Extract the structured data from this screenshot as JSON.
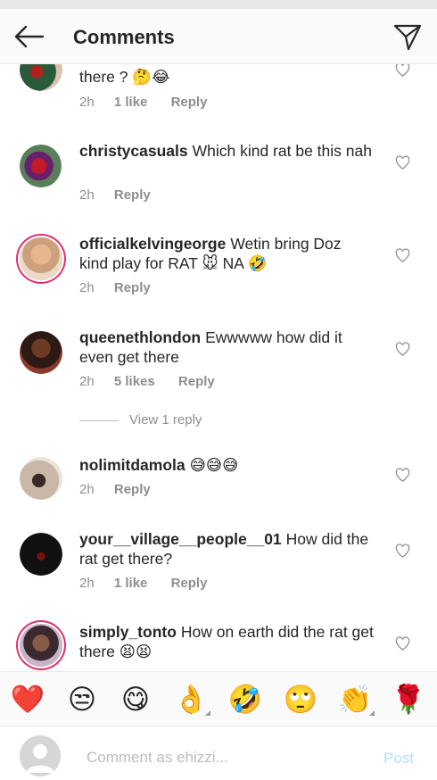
{
  "header": {
    "title": "Comments"
  },
  "comments": [
    {
      "text": "there ? 🤔😂",
      "time": "2h",
      "likes": "1 like",
      "reply": "Reply"
    },
    {
      "user": "christycasuals",
      "text": "Which kind rat be this nah",
      "time": "2h",
      "reply": "Reply"
    },
    {
      "user": "officialkelvingeorge",
      "text": "Wetin bring Doz kind play for RAT 🐭 NA 🤣",
      "time": "2h",
      "reply": "Reply"
    },
    {
      "user": "queenethlondon",
      "text": "Ewwwww how did it even get there",
      "time": "2h",
      "likes": "5 likes",
      "reply": "Reply"
    },
    {
      "user": "nolimitdamola",
      "text": "😅😅😅",
      "time": "2h",
      "reply": "Reply"
    },
    {
      "user": "your__village__people__01",
      "text": "How did the rat get there?",
      "time": "2h",
      "likes": "1 like",
      "reply": "Reply"
    },
    {
      "user": "simply_tonto",
      "text": "How on earth did the rat get there 😫😫"
    }
  ],
  "view_replies": "View 1 reply",
  "emoji_bar": [
    "❤️",
    "😒",
    "😋",
    "👌",
    "🤣",
    "🙄",
    "👏",
    "🌹"
  ],
  "composer": {
    "placeholder": "Comment as ehizzi...",
    "post_label": "Post"
  },
  "colors": {
    "accent_blue": "#3897f0",
    "post_disabled": "#b2dffc",
    "meta_gray": "#8e8e8e"
  }
}
